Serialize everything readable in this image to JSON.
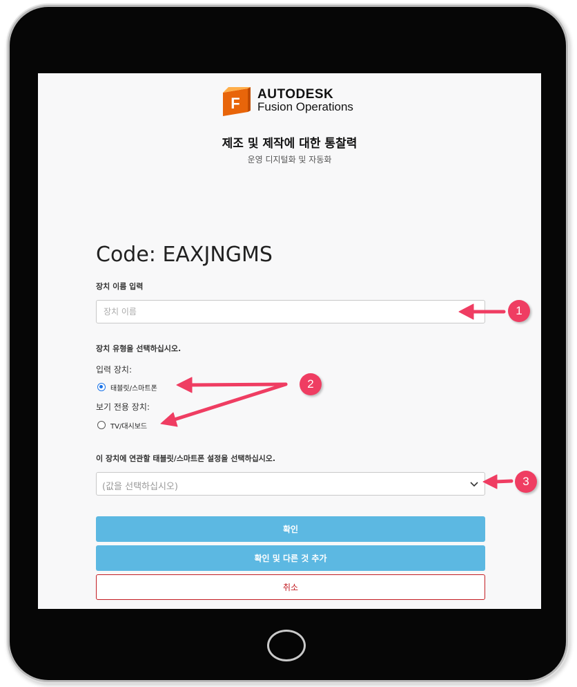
{
  "brand": {
    "company": "AUTODESK",
    "product": "Fusion Operations",
    "logo_letter": "F",
    "logo_color": "#f37b1d"
  },
  "header": {
    "headline": "제조 및 제작에 대한 통찰력",
    "subheadline": "운영 디지털화 및 자동화"
  },
  "form": {
    "code_title": "Code: EAXJNGMS",
    "device_name_label": "장치 이름 입력",
    "device_name_placeholder": "장치 이름",
    "device_name_value": "",
    "device_type_label": "장치 유형을 선택하십시오.",
    "input_device_heading": "입력 장치:",
    "radio_tablet_label": "태블릿/스마트폰",
    "view_only_heading": "보기 전용 장치:",
    "radio_tv_label": "TV/대시보드",
    "selected_device_type": "태블릿/스마트폰",
    "settings_select_label": "이 장치에 연관할 태블릿/스마트폰 설정을 선택하십시오.",
    "settings_select_value": "(값을 선택하십시오)",
    "confirm_button": "확인",
    "confirm_add_button": "확인 및 다른 것 추가",
    "cancel_button": "취소"
  },
  "annotations": {
    "badges": [
      "1",
      "2",
      "3"
    ],
    "color": "#ef3d62"
  },
  "colors": {
    "primary_button": "#5cb8e2",
    "cancel_accent": "#c21c22",
    "radio_accent": "#1a73e8"
  }
}
